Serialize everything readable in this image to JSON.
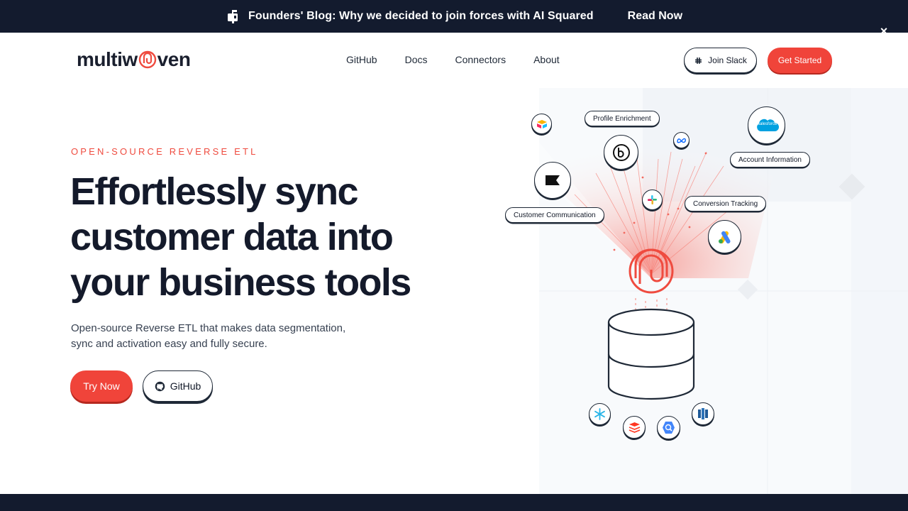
{
  "announcement": {
    "message": "Founders' Blog: Why we decided to join forces with AI Squared",
    "cta": "Read Now",
    "close": "×"
  },
  "nav": {
    "logo_left": "multiw",
    "logo_right": "ven",
    "links": [
      "GitHub",
      "Docs",
      "Connectors",
      "About"
    ],
    "slack_button": "Join Slack",
    "start_button": "Get Started"
  },
  "hero": {
    "eyebrow": "OPEN-SOURCE REVERSE ETL",
    "headline": [
      "Effortlessly sync",
      "customer data into",
      "your business tools"
    ],
    "subtext": [
      "Open-source Reverse ETL that makes data segmentation,",
      "sync and activation easy and fully secure."
    ],
    "try_button": "Try Now",
    "github_button": "GitHub"
  },
  "illustration": {
    "labels": {
      "profile": "Profile Enrichment",
      "account": "Account Information",
      "conversion": "Conversion Tracking",
      "customer": "Customer Communication",
      "salesforce": "salesforce"
    }
  },
  "colors": {
    "brand_red": "#f0443a",
    "dark": "#131b2e"
  }
}
